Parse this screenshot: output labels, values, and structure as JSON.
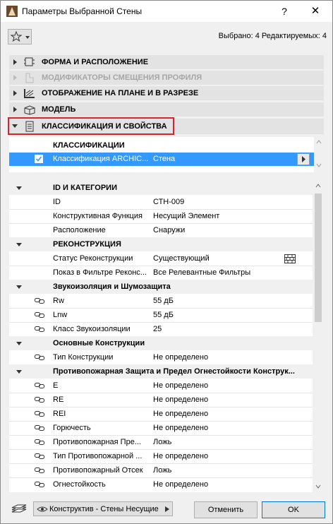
{
  "window": {
    "title": "Параметры Выбранной Стены",
    "help": "?",
    "close": "✕"
  },
  "status": "Выбрано: 4 Редактируемых: 4",
  "sections": [
    {
      "label": "ФОРМА И РАСПОЛОЖЕНИЕ"
    },
    {
      "label": "МОДИФИКАТОРЫ СМЕЩЕНИЯ ПРОФИЛЯ"
    },
    {
      "label": "ОТОБРАЖЕНИЕ НА ПЛАНЕ И В РАЗРЕЗЕ"
    },
    {
      "label": "МОДЕЛЬ"
    },
    {
      "label": "КЛАССИФИКАЦИЯ И СВОЙСТВА"
    }
  ],
  "classification": {
    "header": "КЛАССИФИКАЦИИ",
    "row_name": "Классификация ARCHIC...",
    "row_value": "Стена"
  },
  "groups": {
    "id": "ID И КАТЕГОРИИ",
    "recon": "РЕКОНСТРУКЦИЯ",
    "sound": "Звукоизоляция и Шумозащита",
    "basic": "Основные Конструкции",
    "fire": "Противопожарная Защита и Предел Огнестойкости Конструк..."
  },
  "rows": {
    "id_name": "ID",
    "id_value": "СТН-009",
    "func_name": "Конструктивная Функция",
    "func_value": "Несущий Элемент",
    "pos_name": "Расположение",
    "pos_value": "Снаружи",
    "rstatus_name": "Статус Реконструкции",
    "rstatus_value": "Существующий",
    "rfilter_name": "Показ в Фильтре Реконс...",
    "rfilter_value": "Все Релевантные Фильтры",
    "rw_name": "Rw",
    "rw_value": "55 дБ",
    "lnw_name": "Lnw",
    "lnw_value": "55 дБ",
    "sclass_name": "Класс Звукоизоляции",
    "sclass_value": "25",
    "ctype_name": "Тип Конструкции",
    "ctype_value": "Не определено",
    "e_name": "E",
    "e_value": "Не определено",
    "re_name": "RE",
    "re_value": "Не определено",
    "rei_name": "REI",
    "rei_value": "Не определено",
    "burn_name": "Горючесть",
    "burn_value": "Не определено",
    "fireobst_name": "Противопожарная Пре...",
    "fireobst_value": "Ложь",
    "firetype_name": "Тип Противопожарной ...",
    "firetype_value": "Не определено",
    "firecomp_name": "Противопожарный Отсек",
    "firecomp_value": "Ложь",
    "fireres_name": "Огнестойкость",
    "fireres_value": "Не определено"
  },
  "footer": {
    "favorite": "Конструктив - Стены Несущие",
    "cancel": "Отменить",
    "ok": "OK"
  }
}
